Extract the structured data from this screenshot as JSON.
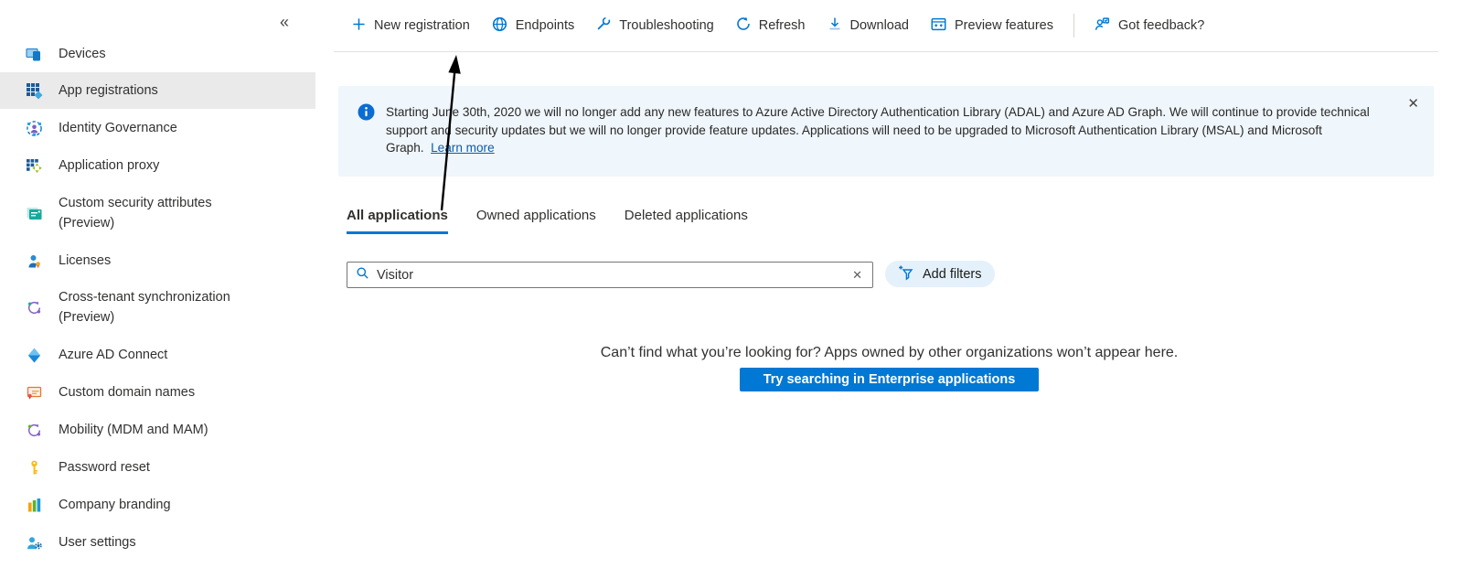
{
  "colors": {
    "accent": "#0078d4",
    "banner_bg": "#eff6fc",
    "selected_bg": "#eaeaea",
    "button_bg": "#0078d4"
  },
  "sidebar": {
    "collapse_icon": "«",
    "items": [
      {
        "label": "Devices",
        "icon": "devices-icon"
      },
      {
        "label": "App registrations",
        "icon": "app-registrations-icon",
        "selected": true
      },
      {
        "label": "Identity Governance",
        "icon": "identity-governance-icon"
      },
      {
        "label": "Application proxy",
        "icon": "application-proxy-icon"
      },
      {
        "label": "Custom security attributes (Preview)",
        "icon": "custom-security-attributes-icon"
      },
      {
        "label": "Licenses",
        "icon": "licenses-icon"
      },
      {
        "label": "Cross-tenant synchronization (Preview)",
        "icon": "cross-tenant-sync-icon"
      },
      {
        "label": "Azure AD Connect",
        "icon": "azure-ad-connect-icon"
      },
      {
        "label": "Custom domain names",
        "icon": "custom-domain-names-icon"
      },
      {
        "label": "Mobility (MDM and MAM)",
        "icon": "mobility-icon"
      },
      {
        "label": "Password reset",
        "icon": "password-reset-icon"
      },
      {
        "label": "Company branding",
        "icon": "company-branding-icon"
      },
      {
        "label": "User settings",
        "icon": "user-settings-icon"
      }
    ]
  },
  "toolbar": {
    "items": [
      {
        "label": "New registration",
        "icon": "plus-icon"
      },
      {
        "label": "Endpoints",
        "icon": "globe-icon"
      },
      {
        "label": "Troubleshooting",
        "icon": "wrench-icon"
      },
      {
        "label": "Refresh",
        "icon": "refresh-icon"
      },
      {
        "label": "Download",
        "icon": "download-icon"
      },
      {
        "label": "Preview features",
        "icon": "preview-features-icon"
      },
      {
        "label": "Got feedback?",
        "icon": "feedback-icon"
      }
    ]
  },
  "banner": {
    "text": "Starting June 30th, 2020 we will no longer add any new features to Azure Active Directory Authentication Library (ADAL) and Azure AD Graph. We will continue to provide technical support and security updates but we will no longer provide feature updates. Applications will need to be upgraded to Microsoft Authentication Library (MSAL) and Microsoft Graph.",
    "link_label": "Learn more",
    "close_icon": "✕"
  },
  "tabs": [
    {
      "label": "All applications",
      "active": true
    },
    {
      "label": "Owned applications",
      "active": false
    },
    {
      "label": "Deleted applications",
      "active": false
    }
  ],
  "search": {
    "value": "Visitor",
    "clear_icon": "✕"
  },
  "filters": {
    "add_filters_label": "Add filters"
  },
  "empty_state": {
    "message": "Can’t find what you’re looking for? Apps owned by other organizations won’t appear here.",
    "button_label": "Try searching in Enterprise applications"
  },
  "annotation": {
    "arrow_points_to": "New registration"
  }
}
